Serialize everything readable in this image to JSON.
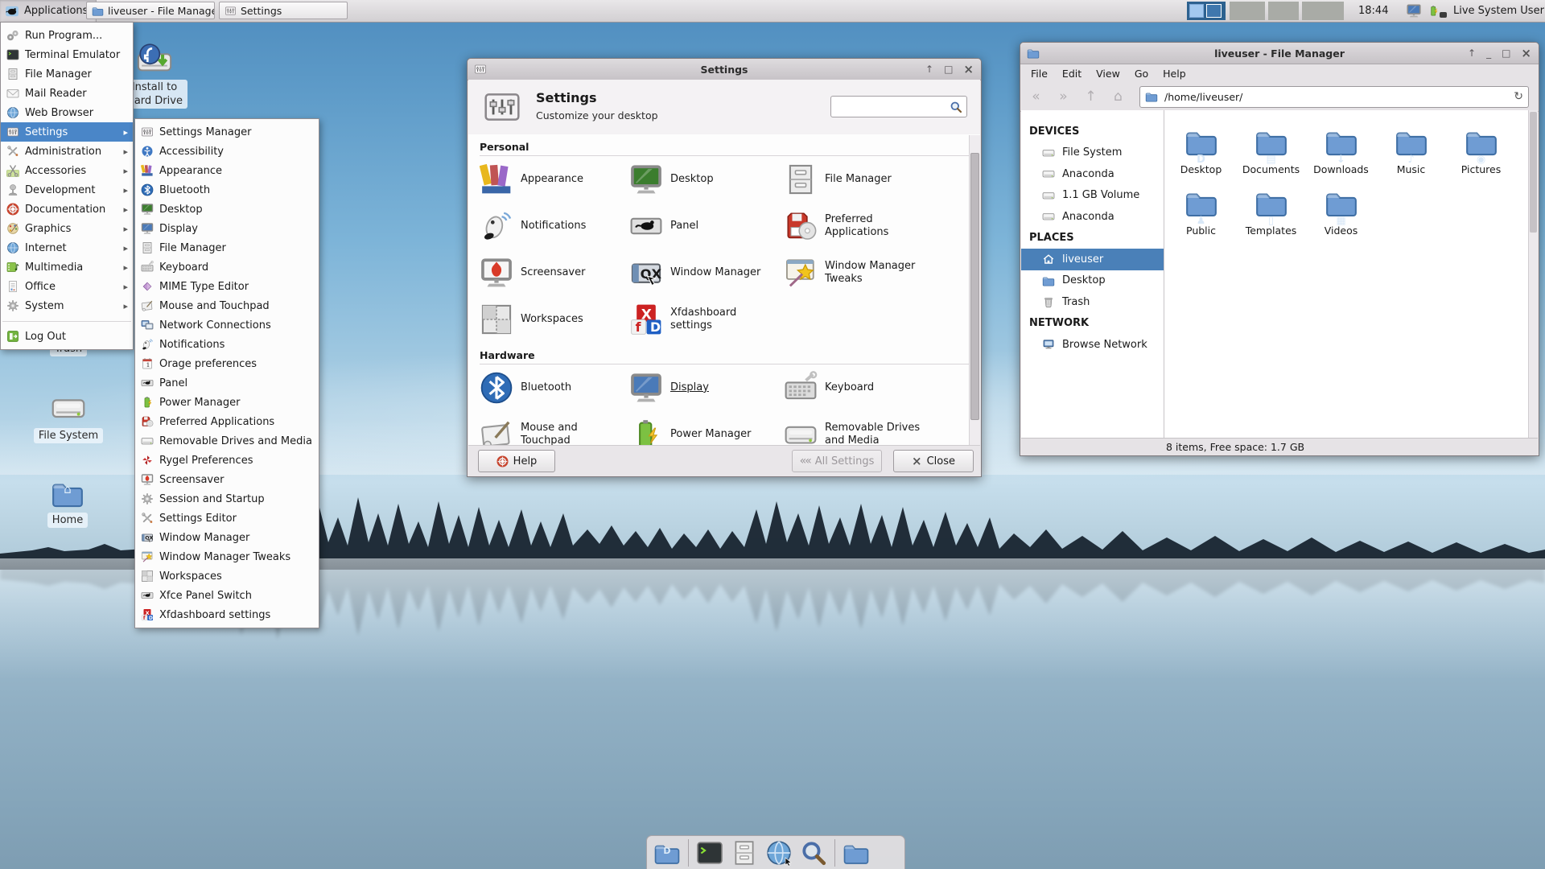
{
  "panel": {
    "applications_label": "Applications",
    "taskbar_buttons": [
      {
        "label": "liveuser - File Manager",
        "icon": "folder"
      },
      {
        "label": "Settings",
        "icon": "mixer"
      }
    ],
    "clock": "18:44",
    "user_label": "Live System User",
    "pager_workspaces": 2
  },
  "icons": {
    "shade": "↑",
    "minimize": "_",
    "maximize": "□",
    "close": "×",
    "back": "«",
    "forward": "»",
    "up": "↑",
    "home": "⌂",
    "reload": "↻",
    "submenu_arrow": "▸",
    "all_settings_arrows": "««"
  },
  "apps_menu": {
    "items": [
      {
        "label": "Run Program...",
        "icon": "run"
      },
      {
        "label": "Terminal Emulator",
        "icon": "terminal"
      },
      {
        "label": "File Manager",
        "icon": "cabinet"
      },
      {
        "label": "Mail Reader",
        "icon": "mail"
      },
      {
        "label": "Web Browser",
        "icon": "globe"
      },
      {
        "label": "Settings",
        "icon": "mixer",
        "submenu": true,
        "selected": true
      },
      {
        "label": "Administration",
        "icon": "tools",
        "submenu": true
      },
      {
        "label": "Accessories",
        "icon": "scissors",
        "submenu": true
      },
      {
        "label": "Development",
        "icon": "joystick",
        "submenu": true
      },
      {
        "label": "Documentation",
        "icon": "lifering",
        "submenu": true
      },
      {
        "label": "Graphics",
        "icon": "palette",
        "submenu": true
      },
      {
        "label": "Internet",
        "icon": "globe",
        "submenu": true
      },
      {
        "label": "Multimedia",
        "icon": "film",
        "submenu": true
      },
      {
        "label": "Office",
        "icon": "office",
        "submenu": true
      },
      {
        "label": "System",
        "icon": "gear",
        "submenu": true
      },
      {
        "separator": true
      },
      {
        "label": "Log Out",
        "icon": "logout"
      }
    ]
  },
  "settings_submenu": {
    "items": [
      {
        "label": "Settings Manager",
        "icon": "mixer"
      },
      {
        "label": "Accessibility",
        "icon": "access"
      },
      {
        "label": "Appearance",
        "icon": "stripes"
      },
      {
        "label": "Bluetooth",
        "icon": "bt"
      },
      {
        "label": "Desktop",
        "icon": "monitor-green"
      },
      {
        "label": "Display",
        "icon": "monitor-blue"
      },
      {
        "label": "File Manager",
        "icon": "cabinet"
      },
      {
        "label": "Keyboard",
        "icon": "keyboard"
      },
      {
        "label": "MIME Type Editor",
        "icon": "diamond"
      },
      {
        "label": "Mouse and Touchpad",
        "icon": "tablet"
      },
      {
        "label": "Network Connections",
        "icon": "twomon"
      },
      {
        "label": "Notifications",
        "icon": "whistle"
      },
      {
        "label": "Orage preferences",
        "icon": "calendar"
      },
      {
        "label": "Panel",
        "icon": "panelmouse"
      },
      {
        "label": "Power Manager",
        "icon": "battery"
      },
      {
        "label": "Preferred Applications",
        "icon": "floppydisc"
      },
      {
        "label": "Removable Drives and Media",
        "icon": "drive"
      },
      {
        "label": "Rygel Preferences",
        "icon": "pinwheel"
      },
      {
        "label": "Screensaver",
        "icon": "flamemon"
      },
      {
        "label": "Session and Startup",
        "icon": "gear"
      },
      {
        "label": "Settings Editor",
        "icon": "tools"
      },
      {
        "label": "Window Manager",
        "icon": "wmbox"
      },
      {
        "label": "Window Manager Tweaks",
        "icon": "startweaks"
      },
      {
        "label": "Workspaces",
        "icon": "wsgrid"
      },
      {
        "label": "Xfce Panel Switch",
        "icon": "panelmouse"
      },
      {
        "label": "Xfdashboard settings",
        "icon": "xfd"
      }
    ]
  },
  "settings_window": {
    "titlebar_title": "Settings",
    "header": {
      "title": "Settings",
      "subtitle": "Customize your desktop"
    },
    "search_value": "",
    "sections": [
      {
        "name": "Personal",
        "tiles": [
          {
            "label": "Appearance",
            "icon": "stripes"
          },
          {
            "label": "Desktop",
            "icon": "monitor-green"
          },
          {
            "label": "File Manager",
            "icon": "cabinet"
          },
          {
            "label": "Notifications",
            "icon": "whistle"
          },
          {
            "label": "Panel",
            "icon": "panelmouse"
          },
          {
            "label": "Preferred Applications",
            "icon": "floppydisc"
          },
          {
            "label": "Screensaver",
            "icon": "flamemon"
          },
          {
            "label": "Window Manager",
            "icon": "wmbox"
          },
          {
            "label": "Window Manager Tweaks",
            "icon": "startweaks"
          },
          {
            "label": "Workspaces",
            "icon": "wsgrid"
          },
          {
            "label": "Xfdashboard settings",
            "icon": "xfd"
          }
        ]
      },
      {
        "name": "Hardware",
        "tiles": [
          {
            "label": "Bluetooth",
            "icon": "bt"
          },
          {
            "label": "Display",
            "icon": "monitor-blue",
            "underline": true
          },
          {
            "label": "Keyboard",
            "icon": "keyboard"
          },
          {
            "label": "Mouse and Touchpad",
            "icon": "tablet"
          },
          {
            "label": "Power Manager",
            "icon": "battery"
          },
          {
            "label": "Removable Drives and Media",
            "icon": "drive"
          }
        ]
      }
    ],
    "buttons": {
      "help": "Help",
      "all_settings": "All Settings",
      "close": "Close"
    }
  },
  "file_manager": {
    "titlebar_title": "liveuser - File Manager",
    "menu_items": [
      "File",
      "Edit",
      "View",
      "Go",
      "Help"
    ],
    "path_value": "/home/liveuser/",
    "sidebar_sections": [
      {
        "header": "DEVICES",
        "items": [
          {
            "label": "File System",
            "icon": "drive"
          },
          {
            "label": "Anaconda",
            "icon": "drive"
          },
          {
            "label": "1.1 GB Volume",
            "icon": "drive"
          },
          {
            "label": "Anaconda",
            "icon": "drive"
          }
        ]
      },
      {
        "header": "PLACES",
        "items": [
          {
            "label": "liveuser",
            "icon": "house",
            "selected": true
          },
          {
            "label": "Desktop",
            "icon": "folder"
          },
          {
            "label": "Trash",
            "icon": "trashcan"
          }
        ]
      },
      {
        "header": "NETWORK",
        "items": [
          {
            "label": "Browse Network",
            "icon": "netpc"
          }
        ]
      }
    ],
    "files": [
      {
        "name": "Desktop",
        "emblem": "desktop"
      },
      {
        "name": "Documents",
        "emblem": "documents"
      },
      {
        "name": "Downloads",
        "emblem": "downloads"
      },
      {
        "name": "Music",
        "emblem": "music"
      },
      {
        "name": "Pictures",
        "emblem": "pictures"
      },
      {
        "name": "Public",
        "emblem": "public"
      },
      {
        "name": "Templates",
        "emblem": "templates"
      },
      {
        "name": "Videos",
        "emblem": "videos"
      }
    ],
    "statusbar": "8 items, Free space: 1.7 GB"
  },
  "desktop_icons": {
    "install": {
      "label_line1": "Install to",
      "label_line2": "Hard Drive"
    },
    "trash": "Trash",
    "file_system": "File System",
    "home": "Home"
  },
  "dock": {
    "items": [
      {
        "name": "show-desktop",
        "icon": "folder",
        "emblem": "desktop"
      },
      {
        "name": "terminal",
        "icon": "terminal"
      },
      {
        "name": "file-manager",
        "icon": "cabinet"
      },
      {
        "name": "web-browser",
        "icon": "globe",
        "overlay": "cursor"
      },
      {
        "name": "app-finder",
        "icon": "search"
      },
      {
        "name": "folder",
        "icon": "folder"
      }
    ]
  },
  "colors": {
    "selection": "#4a86c8",
    "panel_bg": "#dcd9dc",
    "folder_blue": "#6f9cd3",
    "pager_bg": "#2d618f"
  }
}
